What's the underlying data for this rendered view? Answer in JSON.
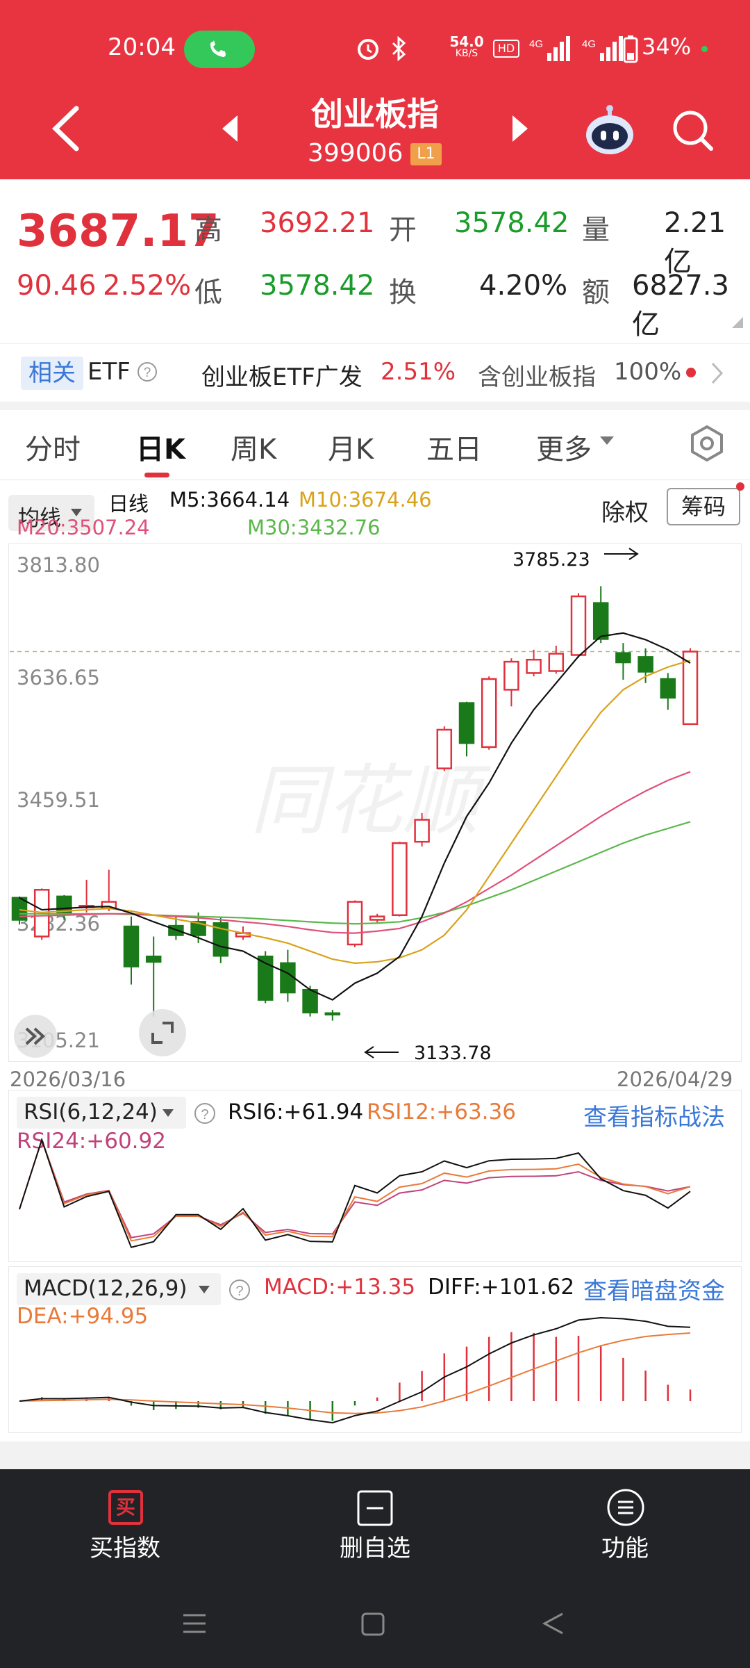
{
  "status": {
    "time": "20:04",
    "net_speed_top": "54.0",
    "net_speed_bottom": "KB/S",
    "battery": "34%"
  },
  "nav": {
    "title": "创业板指",
    "code": "399006",
    "level": "L1"
  },
  "quote": {
    "price": "3687.17",
    "change": "90.46",
    "change_pct": "2.52%",
    "high_label": "高",
    "high": "3692.21",
    "open_label": "开",
    "open": "3578.42",
    "volume_label": "量",
    "volume": "2.21亿",
    "low_label": "低",
    "low": "3578.42",
    "turnover_label": "换",
    "turnover": "4.20%",
    "amount_label": "额",
    "amount": "6827.3亿"
  },
  "etf": {
    "tag": "相关",
    "type": "ETF",
    "name": "创业板ETF广发",
    "pct": "2.51%",
    "contains": "含创业板指",
    "weight": "100%"
  },
  "tabs": [
    "分时",
    "日K",
    "周K",
    "月K",
    "五日",
    "更多"
  ],
  "ma": {
    "toggle": "均线",
    "period": "日线",
    "m5": "M5:3664.14",
    "m10": "M10:3674.46",
    "m20": "M20:3507.24",
    "m30": "M30:3432.76",
    "exright_label": "除权",
    "chips_label": "筹码"
  },
  "kchart": {
    "y_labels": [
      "3813.80",
      "3636.65",
      "3459.51",
      "3282.36",
      "3105.21"
    ],
    "high_annotation": "3785.23",
    "low_annotation": "3133.78",
    "date_start": "2026/03/16",
    "date_end": "2026/04/29"
  },
  "rsi": {
    "selector": "RSI(6,12,24)",
    "rsi6": "RSI6:+61.94",
    "rsi12": "RSI12:+63.36",
    "rsi24": "RSI24:+60.92",
    "link": "查看指标战法"
  },
  "macd": {
    "selector": "MACD(12,26,9)",
    "macd": "MACD:+13.35",
    "diff": "DIFF:+101.62",
    "dea": "DEA:+94.95",
    "link": "查看暗盘资金"
  },
  "bottom": {
    "buy_icon": "买",
    "buy_label": "买指数",
    "remove_label": "删自选",
    "func_label": "功能"
  },
  "colors": {
    "header_red": "#e83440",
    "up_red": "#e0313c",
    "down_green": "#1a7a1a",
    "ma5": "#111111",
    "ma10": "#d9a21b",
    "ma20": "#e0507a",
    "ma30": "#5ab84a"
  },
  "chart_data": {
    "type": "candlestick",
    "y_range": [
      3105.21,
      3813.8
    ],
    "candles": [
      {
        "o": 3318,
        "c": 3285,
        "h": 3320,
        "l": 3278
      },
      {
        "o": 3260,
        "c": 3330,
        "h": 3332,
        "l": 3255
      },
      {
        "o": 3320,
        "c": 3295,
        "h": 3322,
        "l": 3285
      },
      {
        "o": 3304,
        "c": 3306,
        "h": 3345,
        "l": 3296
      },
      {
        "o": 3302,
        "c": 3312,
        "h": 3360,
        "l": 3298
      },
      {
        "o": 3275,
        "c": 3215,
        "h": 3290,
        "l": 3188
      },
      {
        "o": 3230,
        "c": 3222,
        "h": 3260,
        "l": 3140
      },
      {
        "o": 3276,
        "c": 3262,
        "h": 3292,
        "l": 3255
      },
      {
        "o": 3282,
        "c": 3262,
        "h": 3296,
        "l": 3250
      },
      {
        "o": 3280,
        "c": 3231,
        "h": 3290,
        "l": 3220
      },
      {
        "o": 3260,
        "c": 3265,
        "h": 3275,
        "l": 3255
      },
      {
        "o": 3230,
        "c": 3165,
        "h": 3238,
        "l": 3160
      },
      {
        "o": 3220,
        "c": 3176,
        "h": 3240,
        "l": 3162
      },
      {
        "o": 3180,
        "c": 3146,
        "h": 3186,
        "l": 3140
      },
      {
        "o": 3145,
        "c": 3144,
        "h": 3150,
        "l": 3133.78
      },
      {
        "o": 3248,
        "c": 3312,
        "h": 3314,
        "l": 3244
      },
      {
        "o": 3285,
        "c": 3290,
        "h": 3294,
        "l": 3280
      },
      {
        "o": 3292,
        "c": 3400,
        "h": 3402,
        "l": 3290
      },
      {
        "o": 3402,
        "c": 3435,
        "h": 3445,
        "l": 3395
      },
      {
        "o": 3512,
        "c": 3570,
        "h": 3575,
        "l": 3508
      },
      {
        "o": 3610,
        "c": 3550,
        "h": 3612,
        "l": 3530
      },
      {
        "o": 3544,
        "c": 3646,
        "h": 3650,
        "l": 3540
      },
      {
        "o": 3630,
        "c": 3672,
        "h": 3677,
        "l": 3605
      },
      {
        "o": 3655,
        "c": 3675,
        "h": 3690,
        "l": 3650
      },
      {
        "o": 3658,
        "c": 3684,
        "h": 3696,
        "l": 3654
      },
      {
        "o": 3682,
        "c": 3770,
        "h": 3775,
        "l": 3678
      },
      {
        "o": 3760,
        "c": 3706,
        "h": 3785.23,
        "l": 3700
      },
      {
        "o": 3685,
        "c": 3671,
        "h": 3700,
        "l": 3645
      },
      {
        "o": 3679,
        "c": 3657,
        "h": 3692,
        "l": 3640
      },
      {
        "o": 3646,
        "c": 3618,
        "h": 3655,
        "l": 3600
      },
      {
        "o": 3578.42,
        "c": 3687.17,
        "h": 3692.21,
        "l": 3578.42
      }
    ],
    "ma5": [
      3318,
      3300,
      3302,
      3304,
      3305,
      3295,
      3282,
      3270,
      3258,
      3245,
      3238,
      3220,
      3205,
      3180,
      3165,
      3190,
      3205,
      3230,
      3290,
      3370,
      3440,
      3490,
      3550,
      3600,
      3640,
      3680,
      3710,
      3715,
      3705,
      3690,
      3670
    ],
    "ma10": [
      3300,
      3296,
      3298,
      3300,
      3302,
      3298,
      3292,
      3286,
      3280,
      3272,
      3265,
      3258,
      3250,
      3238,
      3226,
      3220,
      3222,
      3228,
      3240,
      3262,
      3300,
      3350,
      3400,
      3450,
      3500,
      3550,
      3596,
      3630,
      3650,
      3664,
      3674
    ],
    "ma20": [
      3290,
      3291,
      3292,
      3293,
      3294,
      3294,
      3292,
      3290,
      3288,
      3285,
      3282,
      3279,
      3275,
      3270,
      3266,
      3265,
      3268,
      3272,
      3282,
      3295,
      3312,
      3332,
      3352,
      3374,
      3396,
      3418,
      3440,
      3460,
      3478,
      3494,
      3507
    ],
    "ma30": [
      3294,
      3294,
      3294,
      3294,
      3294,
      3293,
      3292,
      3291,
      3290,
      3289,
      3288,
      3286,
      3284,
      3282,
      3280,
      3279,
      3280,
      3282,
      3288,
      3296,
      3306,
      3318,
      3330,
      3344,
      3358,
      3372,
      3386,
      3400,
      3412,
      3422,
      3432
    ]
  }
}
